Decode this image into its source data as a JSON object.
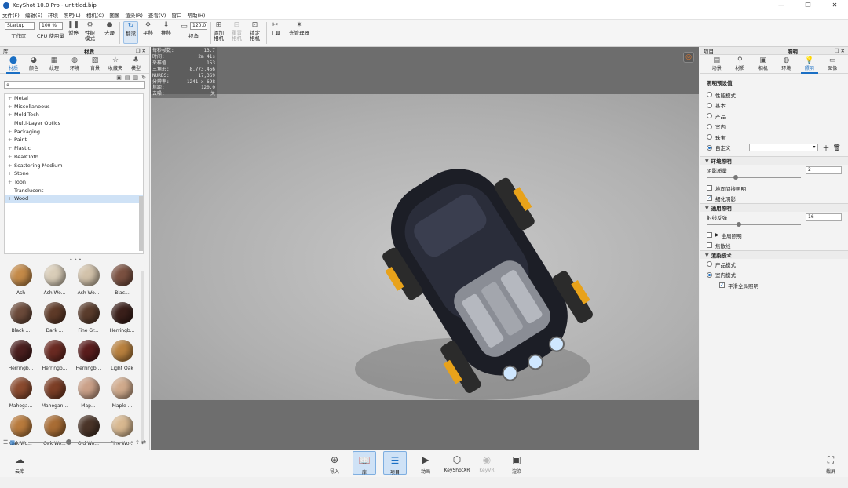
{
  "window": {
    "title": "KeyShot 10.0 Pro  - untitled.bip",
    "controls": [
      "—",
      "❐",
      "✕"
    ]
  },
  "menu": [
    "文件(F)",
    "编辑(E)",
    "环境",
    "照明(L)",
    "相机(C)",
    "图像",
    "渲染(R)",
    "查看(V)",
    "窗口",
    "帮助(H)"
  ],
  "toolbar": {
    "workspace_select": "Startup",
    "zoom_select": "100 %",
    "workspace_label": "工作区",
    "cpu_label": "CPU 使用量",
    "pause_label": "暂停",
    "perf_label_1": "性能",
    "perf_label_2": "模式",
    "denoise_label": "去噪",
    "tumble_label": "翻滚",
    "pan_label": "平移",
    "dolly_label": "推移",
    "fov_value": "120.0",
    "fov_label": "视角",
    "add_cam_1": "添加",
    "add_cam_2": "相机",
    "reset_cam_1": "重置",
    "reset_cam_2": "相机",
    "lock_cam_1": "锁定",
    "lock_cam_2": "相机",
    "tools_label": "工具",
    "light_mgr_label": "光管理器"
  },
  "library": {
    "header_left": "库",
    "header_title": "材质",
    "tabs": [
      {
        "label": "材质",
        "icon": "material-icon"
      },
      {
        "label": "颜色",
        "icon": "color-icon"
      },
      {
        "label": "纹理",
        "icon": "texture-icon"
      },
      {
        "label": "环境",
        "icon": "environment-icon"
      },
      {
        "label": "背景",
        "icon": "background-icon"
      },
      {
        "label": "收藏夹",
        "icon": "favorites-icon"
      },
      {
        "label": "模型",
        "icon": "model-icon"
      }
    ],
    "search_placeholder": "",
    "tree": [
      "Metal",
      "Miscellaneous",
      "Mold-Tech",
      "Multi-Layer Optics",
      "Packaging",
      "Paint",
      "Plastic",
      "RealCloth",
      "Scattering Medium",
      "Stone",
      "Toon",
      "Translucent",
      "Wood"
    ],
    "tree_selected": "Wood",
    "materials": [
      {
        "name": "Ash",
        "color": "#c48a48"
      },
      {
        "name": "Ash Wo...",
        "color": "#d9cdb8"
      },
      {
        "name": "Ash Wo...",
        "color": "#d2c2aa"
      },
      {
        "name": "Blac...",
        "color": "#7a5040"
      },
      {
        "name": "Black ...",
        "color": "#6b4a3a"
      },
      {
        "name": "Dark ...",
        "color": "#5e3a28"
      },
      {
        "name": "Fine Gr...",
        "color": "#5a3c2c"
      },
      {
        "name": "Herringb...",
        "color": "#3a1f1a"
      },
      {
        "name": "Herringb...",
        "color": "#4a1e1e"
      },
      {
        "name": "Herringb...",
        "color": "#6a2a22"
      },
      {
        "name": "Herringb...",
        "color": "#5a1c1c"
      },
      {
        "name": "Light Oak",
        "color": "#b8803e"
      },
      {
        "name": "Mahoga...",
        "color": "#8a4a2e"
      },
      {
        "name": "Mahogan...",
        "color": "#7c3e26"
      },
      {
        "name": "Map...",
        "color": "#caa088"
      },
      {
        "name": "Maple ...",
        "color": "#d0aa8c"
      },
      {
        "name": "Oak Wo...",
        "color": "#b87a3c"
      },
      {
        "name": "Oak Wo...",
        "color": "#a86c34"
      },
      {
        "name": "Old Wo...",
        "color": "#4a3428"
      },
      {
        "name": "Pine Wo...",
        "color": "#d8b890"
      },
      {
        "name": "",
        "color": "#e4d0b4"
      },
      {
        "name": "",
        "color": "#a8642c"
      },
      {
        "name": "",
        "color": "#3a2218"
      }
    ]
  },
  "stats": [
    {
      "k": "每秒帧数:",
      "v": "13.7"
    },
    {
      "k": "时间:",
      "v": "2m 41s"
    },
    {
      "k": "采样值",
      "v": "153"
    },
    {
      "k": "三角形:",
      "v": "8,773,456"
    },
    {
      "k": "NURBS:",
      "v": "17,369"
    },
    {
      "k": "分辨率:",
      "v": "1241 x 698"
    },
    {
      "k": "焦距:",
      "v": "120.0"
    },
    {
      "k": "去噪:",
      "v": "关"
    }
  ],
  "project": {
    "header_left": "项目",
    "header_title": "照明",
    "tabs": [
      {
        "label": "场景",
        "icon": "scene-icon"
      },
      {
        "label": "材质",
        "icon": "material-icon"
      },
      {
        "label": "相机",
        "icon": "camera-icon"
      },
      {
        "label": "环境",
        "icon": "environment-icon"
      },
      {
        "label": "照明",
        "icon": "lighting-icon"
      },
      {
        "label": "图像",
        "icon": "image-icon"
      }
    ],
    "presets_title": "照明预设值",
    "presets": [
      "性能模式",
      "基本",
      "产品",
      "室内",
      "珠宝",
      "自定义"
    ],
    "selected_preset": "自定义",
    "custom_value": "-",
    "env_lighting_title": "环境照明",
    "shadow_quality_label": "阴影质量",
    "shadow_quality_value": "2",
    "ground_gi_label": "地面间接照明",
    "fine_shadow_label": "细化阴影",
    "general_title": "通用照明",
    "ray_bounces_label": "射线反弹",
    "ray_bounces_value": "16",
    "global_illum_label": "全局照明",
    "caustics_label": "焦散线",
    "render_tech_title": "渲染技术",
    "render_modes": [
      "产品模式",
      "室内模式"
    ],
    "selected_mode": "室内模式",
    "smooth_gi_label": "平滑全局照明"
  },
  "bottombar": {
    "cloud_label": "云库",
    "import_label": "导入",
    "library_label": "库",
    "project_label": "项目",
    "animation_label": "动画",
    "keyshotxr_label": "KeyShotXR",
    "keyvr_label": "KeyVR",
    "render_label": "渲染",
    "screenshot_label": "截屏"
  }
}
